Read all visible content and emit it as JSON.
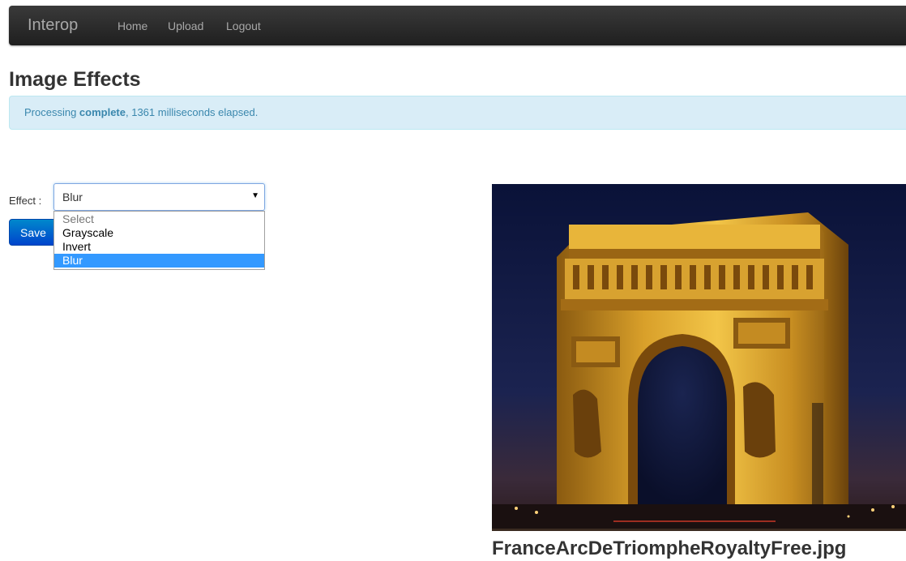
{
  "navbar": {
    "brand": "Interop",
    "links": [
      "Home",
      "Upload",
      "Logout"
    ]
  },
  "page": {
    "title": "Image Effects"
  },
  "alert": {
    "prefix": "Processing ",
    "strong": "complete",
    "suffix": ", 1361 milliseconds elapsed."
  },
  "form": {
    "effect_label": "Effect :",
    "selected_value": "Blur",
    "options": [
      "Select",
      "Grayscale",
      "Invert",
      "Blur"
    ],
    "save_label": "Save"
  },
  "image": {
    "caption": "FranceArcDeTriompheRoyaltyFree.jpg"
  },
  "colors": {
    "navbar": "#222222",
    "alert_bg": "#d9edf7",
    "alert_text": "#3a87ad",
    "primary": "#0066cc",
    "highlight": "#3399ff"
  }
}
